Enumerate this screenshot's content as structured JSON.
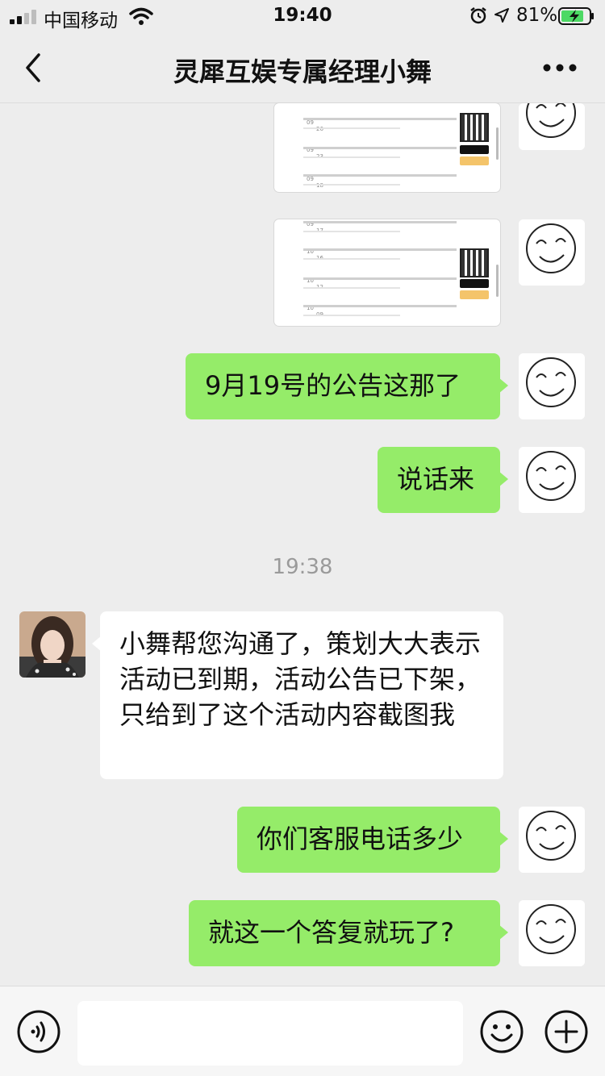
{
  "status_bar": {
    "carrier": "中国移动",
    "time": "19:40",
    "battery": "81%"
  },
  "nav": {
    "title": "灵犀互娱专属经理小舞"
  },
  "shot_one": {
    "nums": [
      "09",
      "26",
      "09",
      "23",
      "09",
      "18"
    ]
  },
  "shot_two": {
    "nums": [
      "09",
      "17",
      "10",
      "16",
      "10",
      "12",
      "10",
      "09"
    ]
  },
  "messages": [
    {
      "from": "me",
      "text": "9月19号的公告这那了"
    },
    {
      "from": "me",
      "text": "说话来"
    },
    {
      "from": "them",
      "text": "小舞帮您沟通了，策划大大表示活动已到期，活动公告已下架，只给到了这个活动内容截图我"
    },
    {
      "from": "me",
      "text": "你们客服电话多少"
    },
    {
      "from": "me",
      "text": "就这一个答复就玩了?"
    }
  ],
  "timestamp": "19:38",
  "input_bar": {
    "value": "",
    "icons": [
      "voice-icon",
      "emoji-icon",
      "plus-icon"
    ]
  },
  "colors": {
    "background": "#ededed",
    "my_bubble": "#95ec69",
    "their_bubble": "#ffffff",
    "battery_charging": "#4cd964"
  }
}
